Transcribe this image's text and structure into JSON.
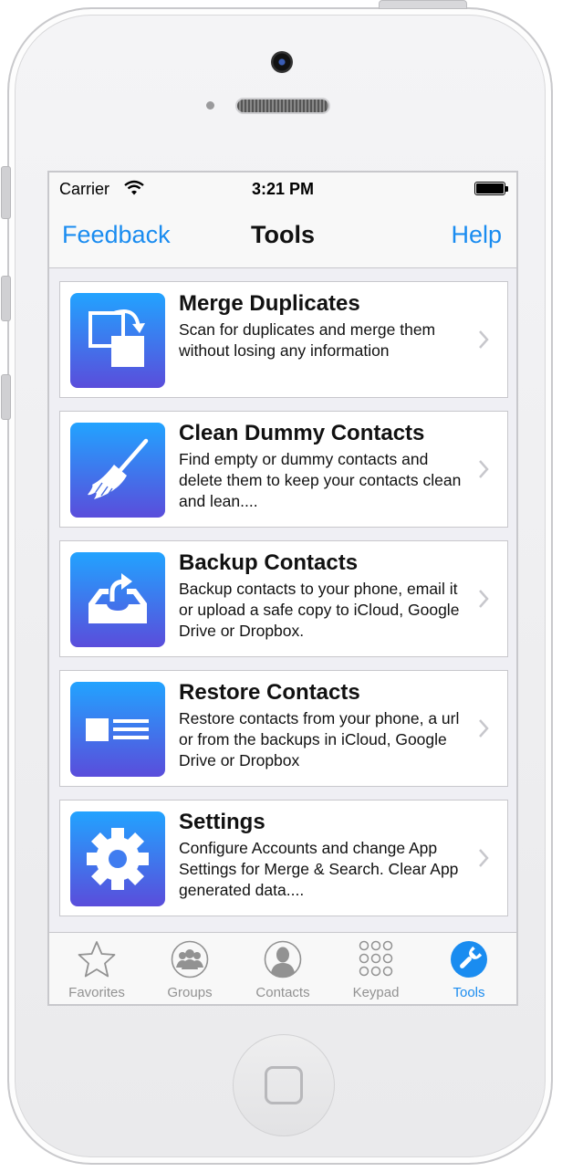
{
  "status_bar": {
    "carrier": "Carrier",
    "time": "3:21 PM"
  },
  "nav": {
    "left": "Feedback",
    "title": "Tools",
    "right": "Help"
  },
  "tools": [
    {
      "title": "Merge Duplicates",
      "description": "Scan for duplicates and merge them without losing any information",
      "icon": "merge-icon"
    },
    {
      "title": "Clean Dummy Contacts",
      "description": "Find empty or dummy contacts and delete them to keep your contacts clean and lean....",
      "icon": "broom-icon"
    },
    {
      "title": "Backup Contacts",
      "description": "Backup contacts to your phone, email it or upload a safe copy to iCloud, Google Drive or Dropbox.",
      "icon": "backup-tray-icon"
    },
    {
      "title": "Restore Contacts",
      "description": "Restore contacts from your phone, a url or from the backups in iCloud, Google Drive or Dropbox",
      "icon": "contact-card-icon"
    },
    {
      "title": "Settings",
      "description": "Configure Accounts and change App Settings for Merge & Search. Clear App generated data....",
      "icon": "gear-icon"
    }
  ],
  "tabs": [
    {
      "label": "Favorites",
      "icon": "star-icon",
      "active": false
    },
    {
      "label": "Groups",
      "icon": "groups-icon",
      "active": false
    },
    {
      "label": "Contacts",
      "icon": "contacts-icon",
      "active": false
    },
    {
      "label": "Keypad",
      "icon": "keypad-icon",
      "active": false
    },
    {
      "label": "Tools",
      "icon": "wrench-icon",
      "active": true
    }
  ],
  "colors": {
    "accent": "#1a8cf0",
    "icon_gradient_top": "#22a3ff",
    "icon_gradient_bottom": "#5a4ddb",
    "inactive": "#929292"
  }
}
